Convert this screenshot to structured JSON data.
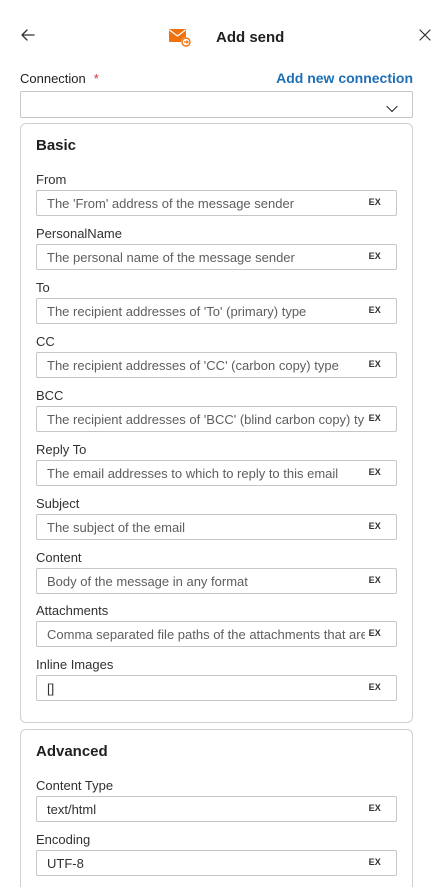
{
  "header": {
    "title": "Add send",
    "icon": "email-send-icon",
    "icon_color": "#f0720f"
  },
  "connection": {
    "label": "Connection",
    "required_mark": "*",
    "add_link": "Add new connection",
    "selected_value": ""
  },
  "basic": {
    "title": "Basic",
    "fields": [
      {
        "label": "From",
        "placeholder": "The 'From' address of the message sender",
        "value": "",
        "ex": "EX"
      },
      {
        "label": "PersonalName",
        "placeholder": "The personal name of the message sender",
        "value": "",
        "ex": "EX"
      },
      {
        "label": "To",
        "placeholder": "The recipient addresses of 'To' (primary) type",
        "value": "",
        "ex": "EX"
      },
      {
        "label": "CC",
        "placeholder": "The recipient addresses of 'CC' (carbon copy) type",
        "value": "",
        "ex": "EX"
      },
      {
        "label": "BCC",
        "placeholder": "The recipient addresses of 'BCC' (blind carbon copy) type",
        "value": "",
        "ex": "EX"
      },
      {
        "label": "Reply To",
        "placeholder": "The email addresses to which to reply to this email",
        "value": "",
        "ex": "EX"
      },
      {
        "label": "Subject",
        "placeholder": "The subject of the email",
        "value": "",
        "ex": "EX"
      },
      {
        "label": "Content",
        "placeholder": "Body of the message in any format",
        "value": "",
        "ex": "EX"
      },
      {
        "label": "Attachments",
        "placeholder": "Comma separated file paths of the attachments that are",
        "value": "",
        "ex": "EX"
      },
      {
        "label": "Inline Images",
        "placeholder": "",
        "value": "[]",
        "ex": "EX"
      }
    ]
  },
  "advanced": {
    "title": "Advanced",
    "fields": [
      {
        "label": "Content Type",
        "placeholder": "",
        "value": "text/html",
        "ex": "EX"
      },
      {
        "label": "Encoding",
        "placeholder": "",
        "value": "UTF-8",
        "ex": "EX"
      }
    ]
  }
}
